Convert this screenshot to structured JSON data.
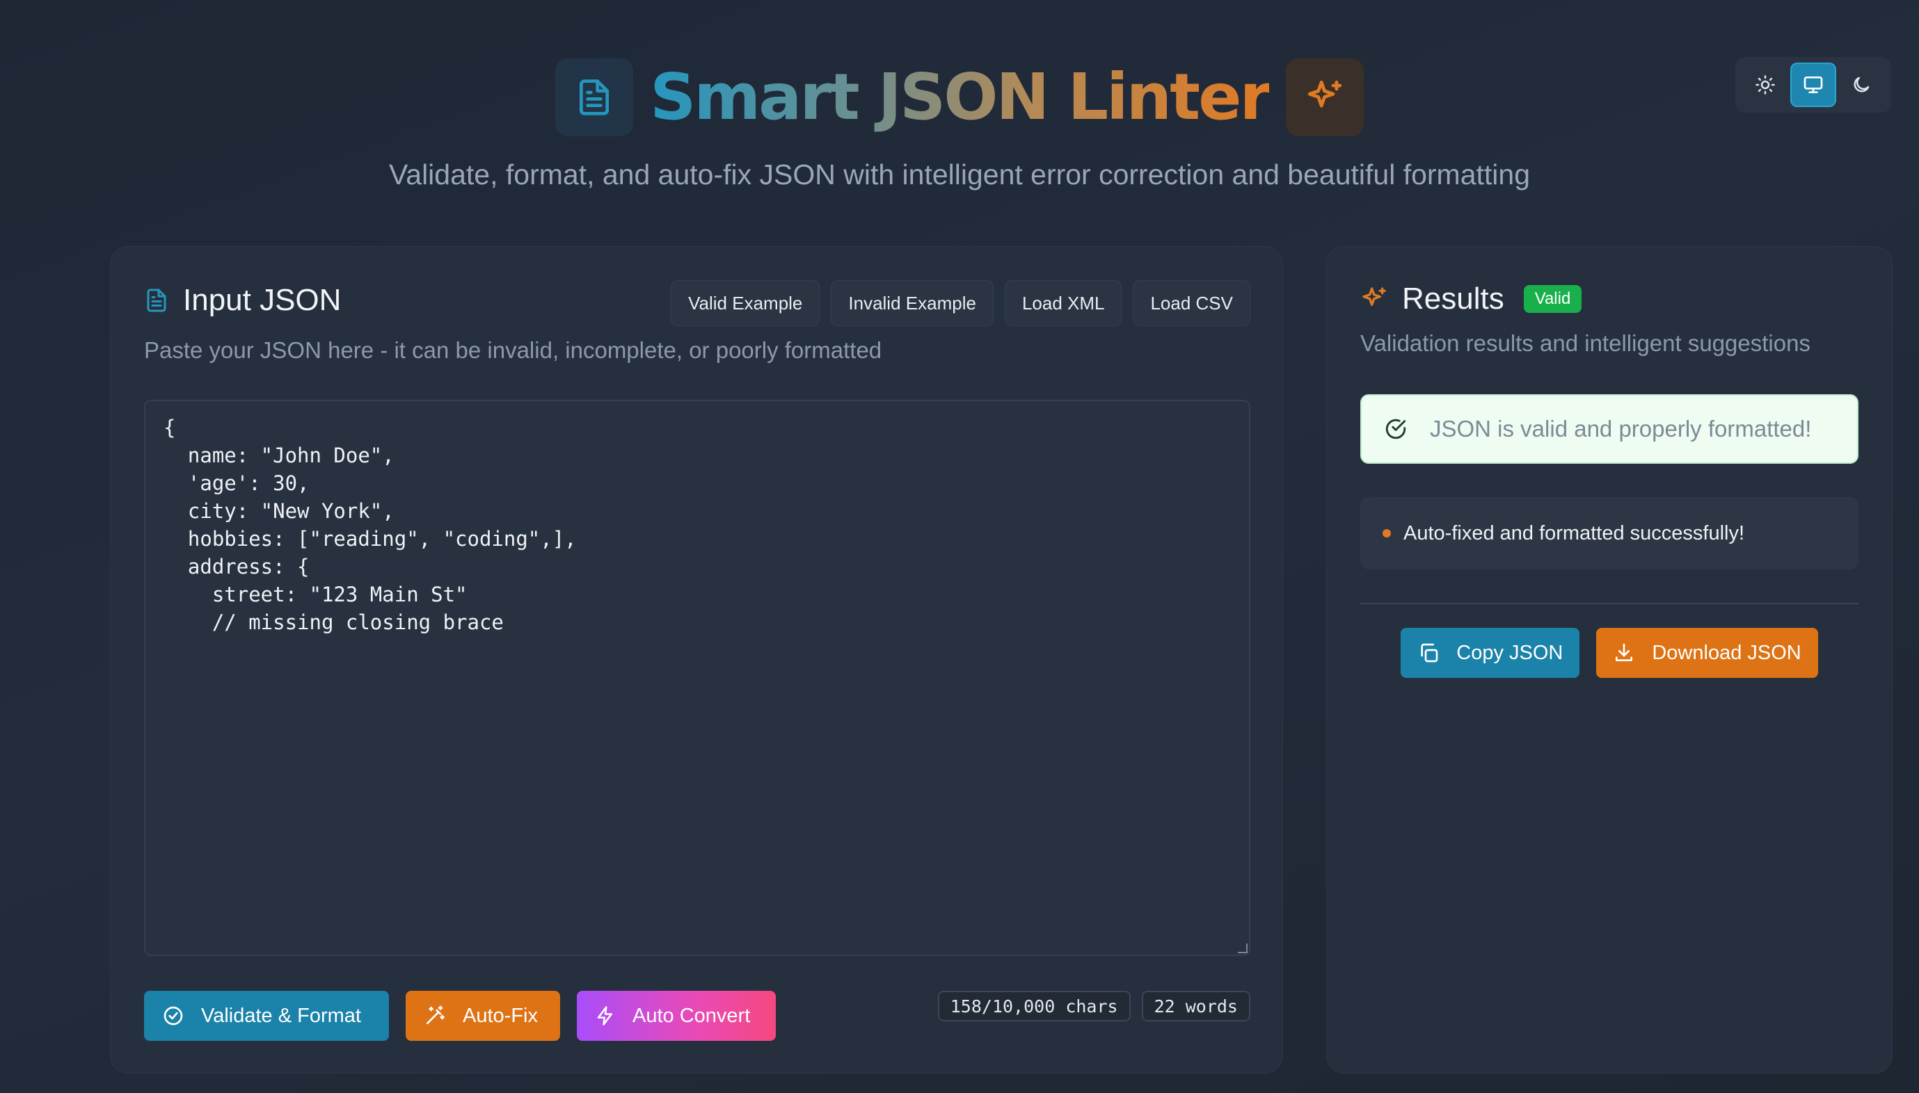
{
  "header": {
    "title": "Smart JSON Linter",
    "subtitle": "Validate, format, and auto-fix JSON with intelligent error correction and beautiful formatting"
  },
  "theme_toggle": {
    "options": [
      "light",
      "system",
      "dark"
    ],
    "active": "system"
  },
  "input_card": {
    "title": "Input JSON",
    "description": "Paste your JSON here - it can be invalid, incomplete, or poorly formatted",
    "example_buttons": [
      "Valid Example",
      "Invalid Example",
      "Load XML",
      "Load CSV"
    ],
    "editor_value": "{\n  name: \"John Doe\",\n  'age': 30,\n  city: \"New York\",\n  hobbies: [\"reading\", \"coding\",],\n  address: {\n    street: \"123 Main St\"\n    // missing closing brace",
    "actions": {
      "validate": "Validate & Format",
      "autofix": "Auto-Fix",
      "convert": "Auto Convert"
    },
    "counters": {
      "chars": "158/10,000 chars",
      "words": "22 words"
    }
  },
  "results_card": {
    "title": "Results",
    "badge": "Valid",
    "description": "Validation results and intelligent suggestions",
    "status_message": "JSON is valid and properly formatted!",
    "messages": [
      "Auto-fixed and formatted successfully!"
    ],
    "actions": {
      "copy": "Copy JSON",
      "download": "Download JSON"
    }
  },
  "colors": {
    "background": "#1f2735",
    "card": "#262f3d",
    "primary_blue": "#1b82a9",
    "accent_orange": "#dd7314",
    "valid_green": "#19b04c"
  }
}
